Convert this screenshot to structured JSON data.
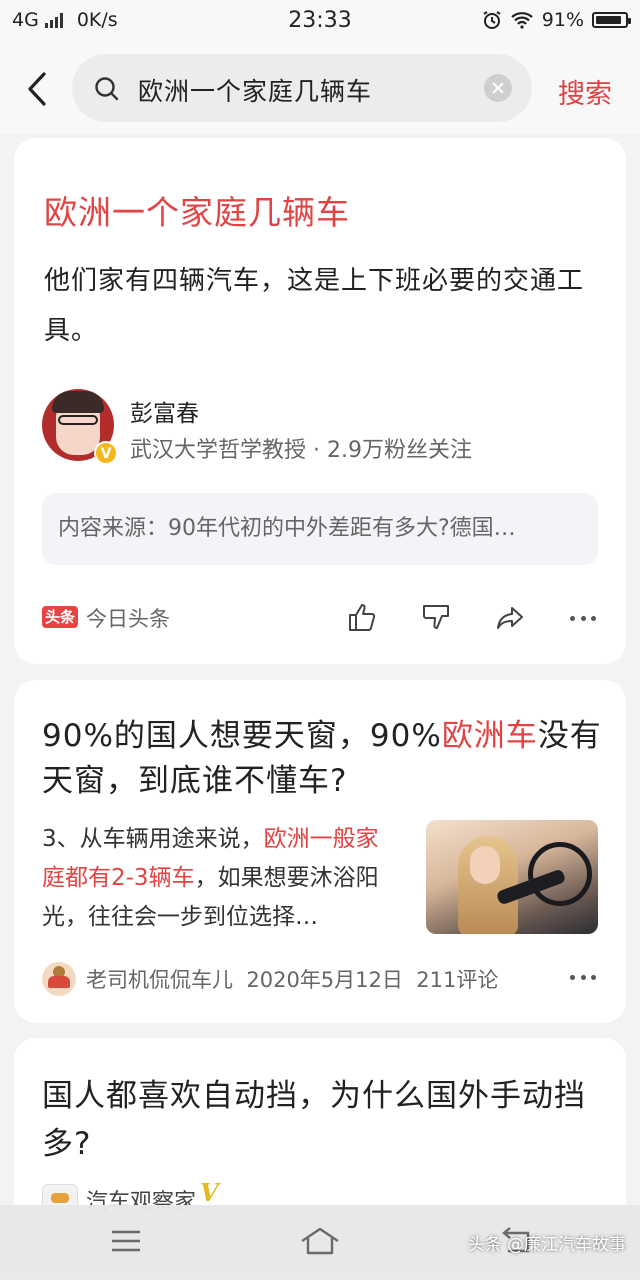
{
  "status_bar": {
    "network": "4G",
    "speed": "0K/s",
    "time": "23:33",
    "battery": "91%",
    "battery_level": 0.91
  },
  "search": {
    "query": "欧洲一个家庭几辆车",
    "button_label": "搜索"
  },
  "result1": {
    "title": "欧洲一个家庭几辆车",
    "body": "他们家有四辆汽车，这是上下班必要的交通工具。",
    "author": "彭富春",
    "author_meta": "武汉大学哲学教授 · 2.9万粉丝关注",
    "verified_badge": "V",
    "source": "内容来源：90年代初的中外差距有多大?德国…",
    "platform_badge": "头条",
    "platform": "今日头条"
  },
  "result2": {
    "title_parts": [
      "90%的国人想要天窗，90%",
      "欧洲车",
      "没有天窗，到底谁不懂车?"
    ],
    "snippet_parts": [
      "3、从车辆用途来说，",
      "欧洲一般家庭都有2-3辆车",
      "，如果想要沐浴阳光，往往会一步到位选择…"
    ],
    "author": "老司机侃侃车儿",
    "date": "2020年5月12日",
    "comments": "211评论"
  },
  "result3": {
    "title": "国人都喜欢自动挡，为什么国外手动挡多?",
    "author": "汽车观察家",
    "verified_badge": "V"
  },
  "watermark": "头条 @廉江汽车故事",
  "colors": {
    "accent": "#e04444",
    "background": "#f3f3f3"
  }
}
